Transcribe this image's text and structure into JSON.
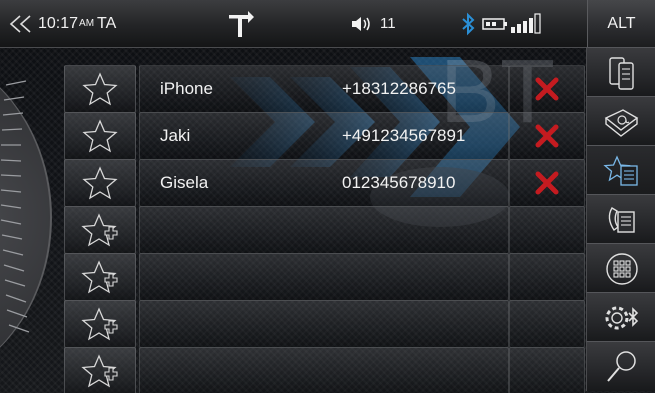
{
  "statusbar": {
    "back_icon": "double-chevron-left-icon",
    "time": "10:17",
    "ampm": "AM",
    "ta": "TA",
    "navigation_icon": "turn-right-arrow-icon",
    "volume_icon": "speaker-volume-icon",
    "volume": "11",
    "bluetooth_icon": "bluetooth-icon",
    "battery_icon": "battery-icon",
    "signal_icon": "signal-bars-icon",
    "alt_label": "ALT"
  },
  "background_text": "BT",
  "favorites": [
    {
      "name": "iPhone",
      "number": "+18312286765",
      "icon": "star-icon",
      "delete_icon": "red-x-delete-icon"
    },
    {
      "name": "Jaki",
      "number": "+491234567891",
      "icon": "star-icon",
      "delete_icon": "red-x-delete-icon"
    },
    {
      "name": "Gisela",
      "number": "012345678910",
      "icon": "star-icon",
      "delete_icon": "red-x-delete-icon"
    },
    {
      "name": "",
      "number": "",
      "icon": "star-add-icon"
    },
    {
      "name": "",
      "number": "",
      "icon": "star-add-icon"
    },
    {
      "name": "",
      "number": "",
      "icon": "star-add-icon"
    },
    {
      "name": "",
      "number": "",
      "icon": "star-add-icon"
    }
  ],
  "sidebar": [
    {
      "name": "phone-devices",
      "icon": "phone-devices-icon"
    },
    {
      "name": "phonebook",
      "icon": "address-book-icon"
    },
    {
      "name": "favorites",
      "icon": "star-list-icon",
      "active": true
    },
    {
      "name": "call-list",
      "icon": "call-list-icon"
    },
    {
      "name": "keypad",
      "icon": "keypad-icon"
    },
    {
      "name": "bluetooth-settings",
      "icon": "gear-bluetooth-icon"
    },
    {
      "name": "search",
      "icon": "search-icon"
    }
  ],
  "colors": {
    "accent_blue": "#2a8fd6",
    "delete_red": "#c41b20",
    "text": "#f2f2f2"
  }
}
